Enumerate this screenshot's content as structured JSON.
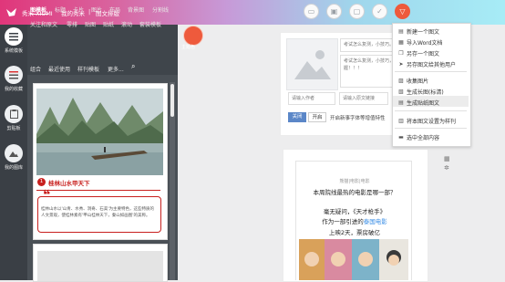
{
  "header": {
    "app_name": "秀米 XIUMI",
    "menu_mine": "我的秀米",
    "separator": "|",
    "page": "图文排版"
  },
  "toolbar": {
    "buttons": [
      {
        "icon": "folder-icon",
        "glyph": "▭"
      },
      {
        "icon": "save-icon",
        "glyph": "▣"
      },
      {
        "icon": "preview-icon",
        "glyph": "▢"
      },
      {
        "icon": "check-icon",
        "glyph": "✓"
      },
      {
        "icon": "more-triangle-icon",
        "glyph": "▽"
      }
    ]
  },
  "rail": {
    "items": [
      {
        "label": "系统模板",
        "active": true
      },
      {
        "label": "我的收藏"
      },
      {
        "label": "剪贴板"
      },
      {
        "label": "我的图库"
      }
    ]
  },
  "categories": {
    "row1": [
      "标题",
      "卡片",
      "图片",
      "布局",
      "背景图",
      "卡片",
      "分割线"
    ],
    "active": "图模板",
    "row2": [
      "关注和原文",
      "零排",
      "贴图",
      "贴纸",
      "滚动",
      "套装模板"
    ],
    "row3": [
      "组合",
      "最近使用",
      "样刊模板",
      "更多..."
    ],
    "theme_label": "主题色"
  },
  "template": {
    "title": "桂林山水甲天下",
    "number": "1",
    "quote_text": "桂林山水以'山青、水秀、洞奇、石美'为主要特色，这些特质的人文景观，使桂林素有'甲山桂林天下，秦山如画图'的美称。"
  },
  "editor": {
    "title_placeholder": "考试怎么复测，小技巧。",
    "summary_placeholder": "考试怎么复测，小技巧，早知道，早撑握！！！",
    "author_placeholder": "请输入作者",
    "link_placeholder": "请输入原文链接",
    "toggle_off": "关闭",
    "toggle_on": "开启",
    "apply_font_text": "开启新事字体等增值特性",
    "article": {
      "kicker": "熊猫|电影|电影",
      "headline": "本周院线最热的电影是哪一部？",
      "line1": "毫无疑问，《天才枪手》",
      "line2a": "作为一部引进的",
      "line2b": "泰国电影",
      "line3": "上映2天，票房破亿"
    }
  },
  "dropdown": {
    "items": [
      {
        "label": "新建一个图文",
        "icon": "new-doc-icon",
        "glyph": "▤"
      },
      {
        "label": "导入Word文档",
        "icon": "word-icon",
        "glyph": "▦"
      },
      {
        "label": "另存一个图文",
        "icon": "copy-icon",
        "glyph": "❐"
      },
      {
        "label": "另存图文给其他用户",
        "icon": "share-icon",
        "glyph": "➤"
      },
      {
        "label": "收集图片",
        "icon": "image-icon",
        "glyph": "▨"
      },
      {
        "label": "生成长图(标清)",
        "icon": "long-image-icon",
        "glyph": "▧"
      },
      {
        "label": "生成贴纸图文",
        "icon": "sticker-icon",
        "glyph": "▤"
      },
      {
        "label": "将本图文设置为样刊",
        "icon": "template-icon",
        "glyph": "▥"
      },
      {
        "label": "选中全部内容",
        "icon": "select-all-icon",
        "glyph": "▬"
      }
    ],
    "highlighted": "生成贴纸图文"
  },
  "colors": {
    "accent": "#ee5a3c",
    "brand_red": "#c8201e",
    "rail_bg": "#3a3f45",
    "toggle_blue": "#5b87c8"
  }
}
